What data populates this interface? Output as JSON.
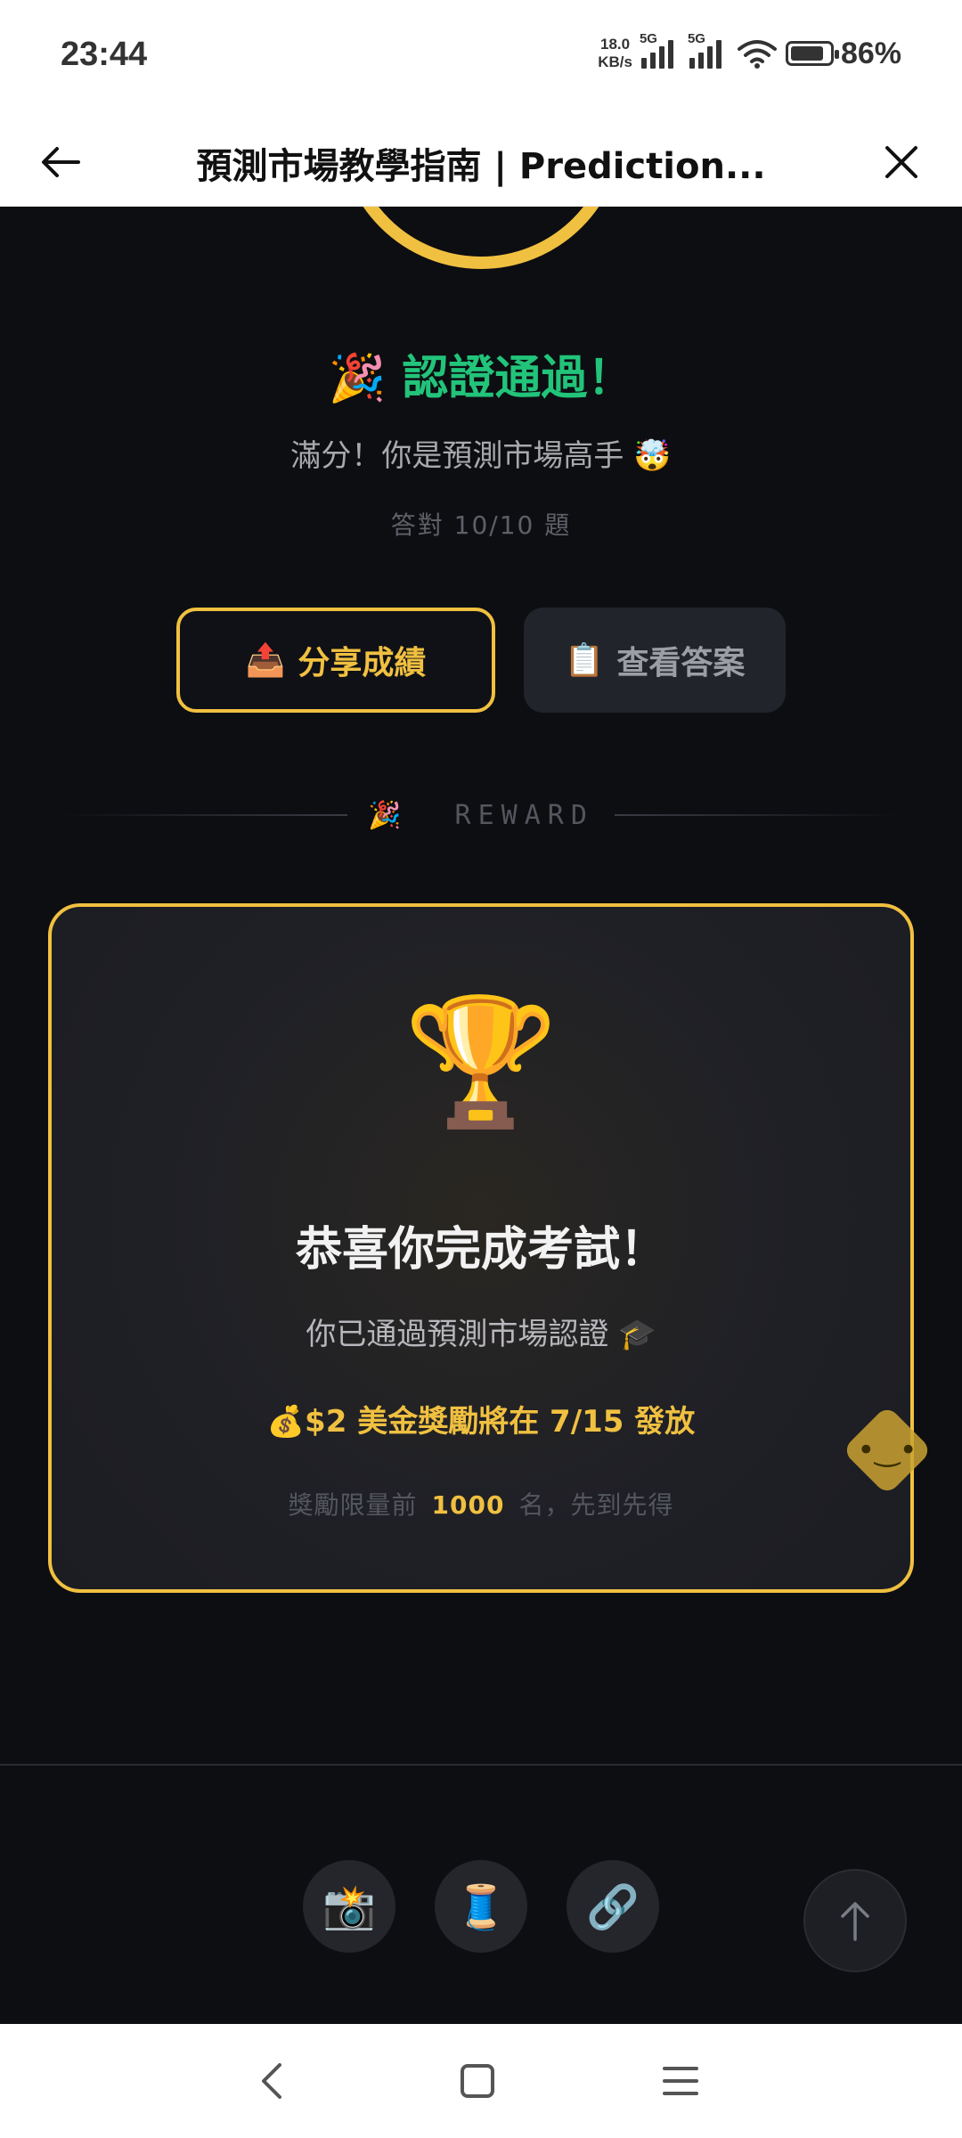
{
  "status_bar": {
    "time": "23:44",
    "net_speed_value": "18.0",
    "net_speed_unit": "KB/s",
    "sim1_label": "5G",
    "sim2_label": "5G",
    "battery_level_percent": 86,
    "battery_text": "86%"
  },
  "app_bar": {
    "title": "預測市場教學指南 | Prediction..."
  },
  "result": {
    "title_emoji": "🎉",
    "title": "認證通過！",
    "subtitle": "滿分！你是預測市場高手 🤯",
    "score": "答對 10/10 題"
  },
  "actions": {
    "share_icon": "📤",
    "share_label": "分享成績",
    "answers_icon": "📋",
    "answers_label": "查看答案"
  },
  "reward_divider": {
    "emoji": "🎉",
    "label": "REWARD"
  },
  "reward_card": {
    "trophy": "🏆",
    "title": "恭喜你完成考試！",
    "subtitle": "你已通過預測市場認證 🎓",
    "reward_line": "💰$2 美金獎勵將在 7/15 發放",
    "limit_prefix": "獎勵限量前",
    "limit_count": "1000",
    "limit_suffix": "名，先到先得"
  },
  "share_row": {
    "camera": "📸",
    "thread": "🧵",
    "link": "🔗"
  },
  "colors": {
    "accent_gold": "#f0c040",
    "success_green": "#22c47a",
    "background": "#0d0e12"
  }
}
